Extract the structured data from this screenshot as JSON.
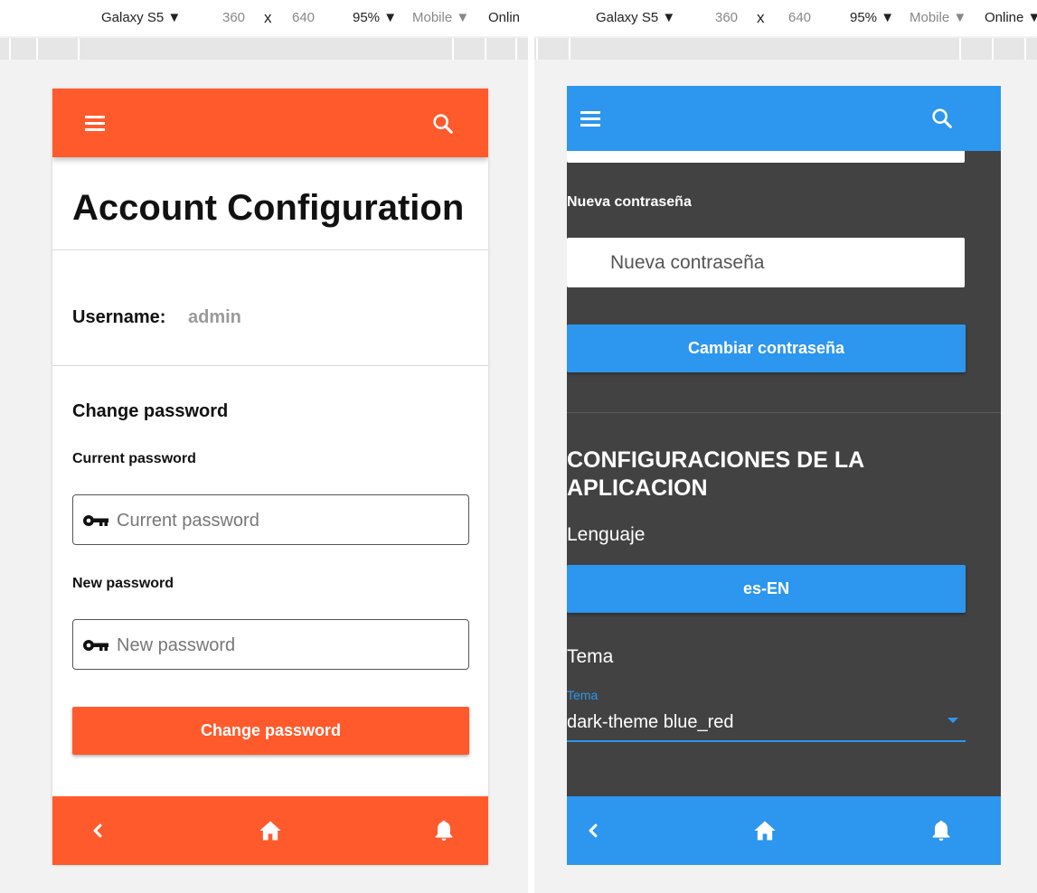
{
  "left": {
    "devtools": {
      "device": "Galaxy S5 ▼",
      "width": "360",
      "times": "x",
      "height": "640",
      "zoom": "95% ▼",
      "mode": "Mobile ▼",
      "network": "Onlin"
    },
    "page_title": "Account Configuration",
    "username_label": "Username:",
    "username_value": "admin",
    "section_title": "Change password",
    "current_label": "Current password",
    "current_placeholder": "Current password",
    "new_label": "New password",
    "new_placeholder": "New password",
    "submit_label": "Change password",
    "accent": "#ff5a2c"
  },
  "right": {
    "devtools": {
      "device": "Galaxy S5 ▼",
      "width": "360",
      "times": "x",
      "height": "640",
      "zoom": "95% ▼",
      "mode": "Mobile ▼",
      "network": "Online ▼"
    },
    "new_label": "Nueva contraseña",
    "new_placeholder": "Nueva contraseña",
    "submit_label": "Cambiar contraseña",
    "section_title_line1": "CONFIGURACIONES DE LA",
    "section_title_line2": "APLICACION",
    "language_label": "Lenguaje",
    "language_value": "es-EN",
    "theme_label": "Tema",
    "theme_field_label": "Tema",
    "theme_value": "dark-theme blue_red",
    "accent": "#2d96ee",
    "background": "#424242"
  },
  "icons": {
    "menu": "hamburger-icon",
    "search": "search-icon",
    "back": "chevron-left-icon",
    "home": "home-icon",
    "notifications": "bell-icon",
    "key": "key-icon",
    "dropdown": "caret-down-icon"
  }
}
